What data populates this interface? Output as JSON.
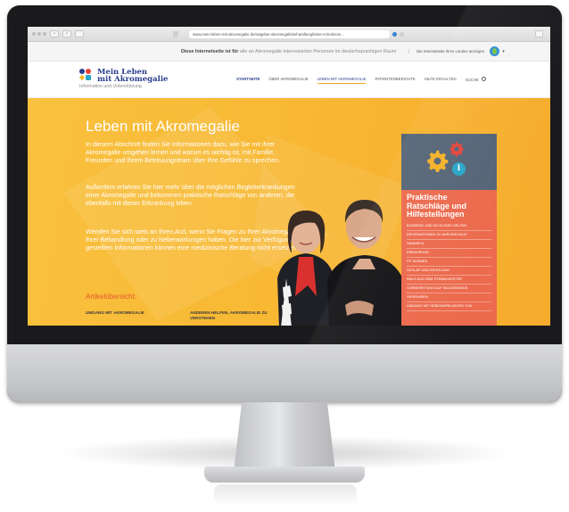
{
  "browser": {
    "url": "www.mein-leben-mit-akromegalie.de/ratgeber-akromegaliebehandlung/leben-mit-akrom..."
  },
  "lang_bar": {
    "notice_bold": "Diese Internetseite ist für",
    "notice_rest": "alle an Akromegalie interessierten Personen im deutschsprachigen Raum",
    "select_label": "Die Internetseite Ihres Landes anzeigen"
  },
  "logo": {
    "line1": "Mein Leben",
    "line2": "mit Akromegalie",
    "tagline": "Information und Unterstützung"
  },
  "nav": {
    "items": [
      "STARTSEITE",
      "ÜBER AKROMEGALIE",
      "LEBEN MIT AKROMEGALIE",
      "PATIENTENBERICHTE",
      "HILFE ERHALTEN",
      "SUCHE"
    ]
  },
  "hero": {
    "title": "Leben mit Akromegalie",
    "p1": "In diesem Abschnitt finden Sie Informationen dazu, wie Sie mit ihrer Akromegalie umgehen lernen und warum es wichtig ist, mit Familie, Freunden und Ihrem Betreuungsteam über Ihre Gefühle zu sprechen.",
    "p2": "Außerdem erfahren Sie hier mehr über die möglichen Begleiterkrankungen einer Akromegalie und bekommen praktische Ratschläge von anderen, die ebenfalls mit dieser Erkrankung leben.",
    "p3": "Wenden Sie sich stets an Ihren Arzt, wenn Sie Fragen zu Ihrer Akromegalie, Ihrer Behandlung oder zu Nebenwirkungen haben. Die hier zur Verfügung gestellten Informationen können eine medizinische Beratung nicht ersetzen."
  },
  "overview": {
    "heading": "Artikelübersicht:",
    "col1": "UMGANG MIT AKROMEGALIE",
    "col2": "ANDEREN HELFEN, AKROMEGALIE ZU VERSTEHEN"
  },
  "sidebar": {
    "title": "Praktische Ratschläge und Hilfestellungen",
    "links": [
      "BLEIBEND UND SCHLÜSSE HELFEN",
      "INFORMATIONEN ZU AKROMEGALIE",
      "SAMMELN",
      "ERNÄHRUNG",
      "FIT BLEIBEN",
      "SCHLAF UND ERHOLUNG",
      "RAUS AUS DEM STIMMUNGSTIEF",
      "VORBEREITUNG AUF BILDGEBENDE",
      "VERFAHREN",
      "UMGANG MIT NEBENWIRKUNGEN VON"
    ]
  },
  "colors": {
    "hero_yellow": "#f8b934",
    "brand_blue": "#2b3d8c",
    "sidebar_coral": "#ec6a4d",
    "sidebar_slate": "#556577",
    "accent_red": "#e4572e"
  }
}
